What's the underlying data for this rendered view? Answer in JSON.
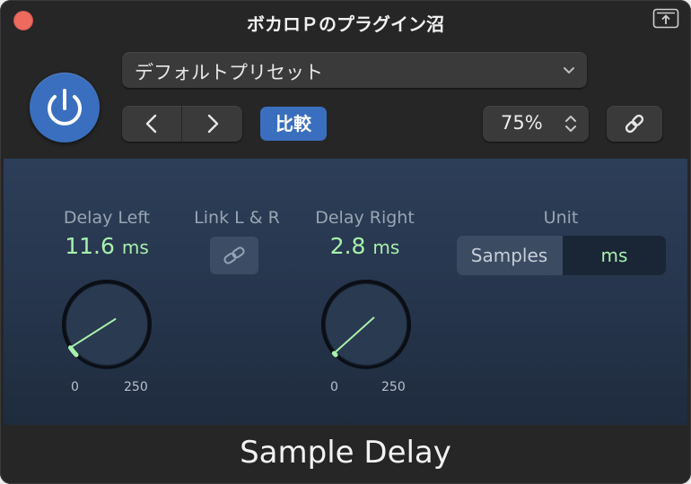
{
  "window": {
    "title": "ボカロＰのプラグイン沼"
  },
  "header": {
    "preset": "デフォルトプリセット",
    "compare_label": "比較",
    "zoom": "75%"
  },
  "plugin": {
    "delay_left": {
      "label": "Delay Left",
      "value": "11.6",
      "unit": "ms",
      "min": "0",
      "max": "250",
      "level": 0.0464
    },
    "link": {
      "label": "Link L & R"
    },
    "delay_right": {
      "label": "Delay Right",
      "value": "2.8",
      "unit": "ms",
      "min": "0",
      "max": "250",
      "level": 0.0112
    },
    "unit": {
      "label": "Unit",
      "options": [
        "Samples",
        "ms"
      ],
      "selected": "ms"
    },
    "name": "Sample Delay"
  },
  "colors": {
    "accent": "#3a6fbf",
    "value_green": "#a8f0ad",
    "close": "#ed6a5e"
  },
  "icons": [
    "close-dot",
    "share-icon",
    "power-icon",
    "chevron-down-icon",
    "chevron-left-icon",
    "chevron-right-icon",
    "updown-chevron-icon",
    "link-icon"
  ]
}
